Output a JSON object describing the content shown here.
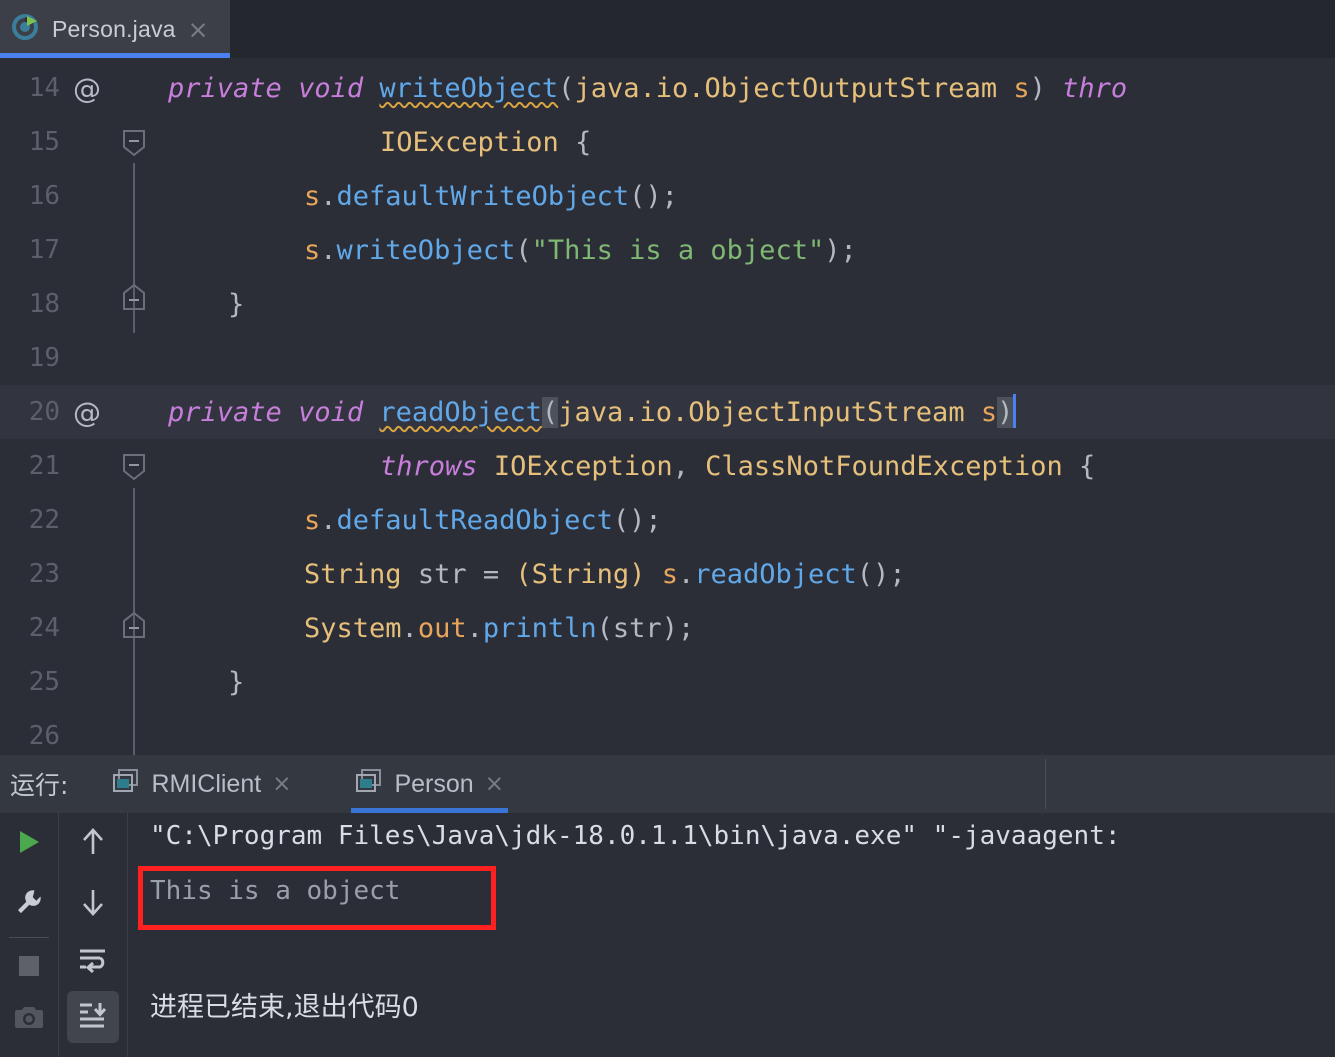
{
  "editor_tab": {
    "icon": "java-class-runnable-icon",
    "label": "Person.java",
    "close": "×"
  },
  "editor": {
    "lines": [
      {
        "num": "14",
        "gutter": "@",
        "fold": "none"
      },
      {
        "num": "15",
        "gutter": "",
        "fold": "start"
      },
      {
        "num": "16",
        "gutter": "",
        "fold": "bar"
      },
      {
        "num": "17",
        "gutter": "",
        "fold": "bar"
      },
      {
        "num": "18",
        "gutter": "",
        "fold": "end"
      },
      {
        "num": "19",
        "gutter": "",
        "fold": "none"
      },
      {
        "num": "20",
        "gutter": "@",
        "fold": "none"
      },
      {
        "num": "21",
        "gutter": "",
        "fold": "start"
      },
      {
        "num": "22",
        "gutter": "",
        "fold": "bar"
      },
      {
        "num": "23",
        "gutter": "",
        "fold": "bar"
      },
      {
        "num": "24",
        "gutter": "",
        "fold": "bar"
      },
      {
        "num": "25",
        "gutter": "",
        "fold": "end"
      },
      {
        "num": "26",
        "gutter": "",
        "fold": "none"
      }
    ],
    "code": {
      "l14": "private void writeObject(java.io.ObjectOutputStream s) thro",
      "l15": "        IOException {",
      "l16": "    s.defaultWriteObject();",
      "l17": "    s.writeObject(\"This is a object\");",
      "l18": "}",
      "l19": "",
      "l20": "private void readObject(java.io.ObjectInputStream s)",
      "l21": "        throws IOException, ClassNotFoundException {",
      "l22": "    s.defaultReadObject();",
      "l23": "    String str = (String) s.readObject();",
      "l24": "    System.out.println(str);",
      "l25": "}",
      "l26": ""
    },
    "tokens": {
      "private": "private",
      "void": "void",
      "throws": "throws",
      "throws_trunc": "thro",
      "writeObject": "writeObject",
      "readObject": "readObject",
      "defaultWriteObject": "defaultWriteObject",
      "defaultReadObject": "defaultReadObject",
      "writeObject_call": "writeObject",
      "readObject_call": "readObject",
      "println": "println",
      "java_io_oos": "java.io.ObjectOutputStream",
      "java_io_ois": "java.io.ObjectInputStream",
      "param_s": "s",
      "IOException": "IOException",
      "ClassNotFoundException": "ClassNotFoundException",
      "String": "String",
      "str": "str",
      "System": "System",
      "out": "out",
      "string_literal": "\"This is a object\"",
      "brace_open": "{",
      "brace_close": "}",
      "paren_open": "(",
      "paren_close": ")",
      "paren_pair": "()",
      "semicolon": ";",
      "comma": ",",
      "dot": ".",
      "equals": "=",
      "cast_String": "(String)",
      "space": " "
    },
    "caret_line": "20"
  },
  "run_panel": {
    "title": "运行:",
    "tabs": [
      {
        "label": "RMIClient",
        "icon": "console-window-icon",
        "close": "×",
        "active": false
      },
      {
        "label": "Person",
        "icon": "console-window-icon",
        "close": "×",
        "active": true
      }
    ],
    "left_toolbar": [
      {
        "name": "rerun-button",
        "icon": "play-icon"
      },
      {
        "name": "settings-button",
        "icon": "wrench-icon"
      },
      {
        "name": "stop-button",
        "icon": "stop-square-icon"
      },
      {
        "name": "screenshot-button",
        "icon": "camera-icon"
      }
    ],
    "right_toolbar": [
      {
        "name": "prev-occurrence-button",
        "icon": "arrow-up-icon",
        "selected": false
      },
      {
        "name": "next-occurrence-button",
        "icon": "arrow-down-icon",
        "selected": false
      },
      {
        "name": "soft-wrap-button",
        "icon": "soft-wrap-icon",
        "selected": false
      },
      {
        "name": "scroll-to-end-button",
        "icon": "scroll-to-end-icon",
        "selected": true
      }
    ],
    "console": {
      "command_line": "\"C:\\Program Files\\Java\\jdk-18.0.1.1\\bin\\java.exe\" \"-javaagent:",
      "program_output": "This is a object",
      "exit_message": "进程已结束,退出代码0"
    }
  },
  "annotation": {
    "highlight_color": "#FF2020",
    "target": "This is a object"
  },
  "colors": {
    "background": "#2B2D37",
    "tab_active": "#3C3F47",
    "tab_underline": "#4A80F0",
    "run_header": "#343841",
    "keyword": "#C87EDB",
    "method": "#61A8E8",
    "type": "#E6C07B",
    "field": "#E8A65B",
    "string": "#7FB872",
    "caret": "#4A80F0",
    "warning_underline": "#D9A441"
  }
}
